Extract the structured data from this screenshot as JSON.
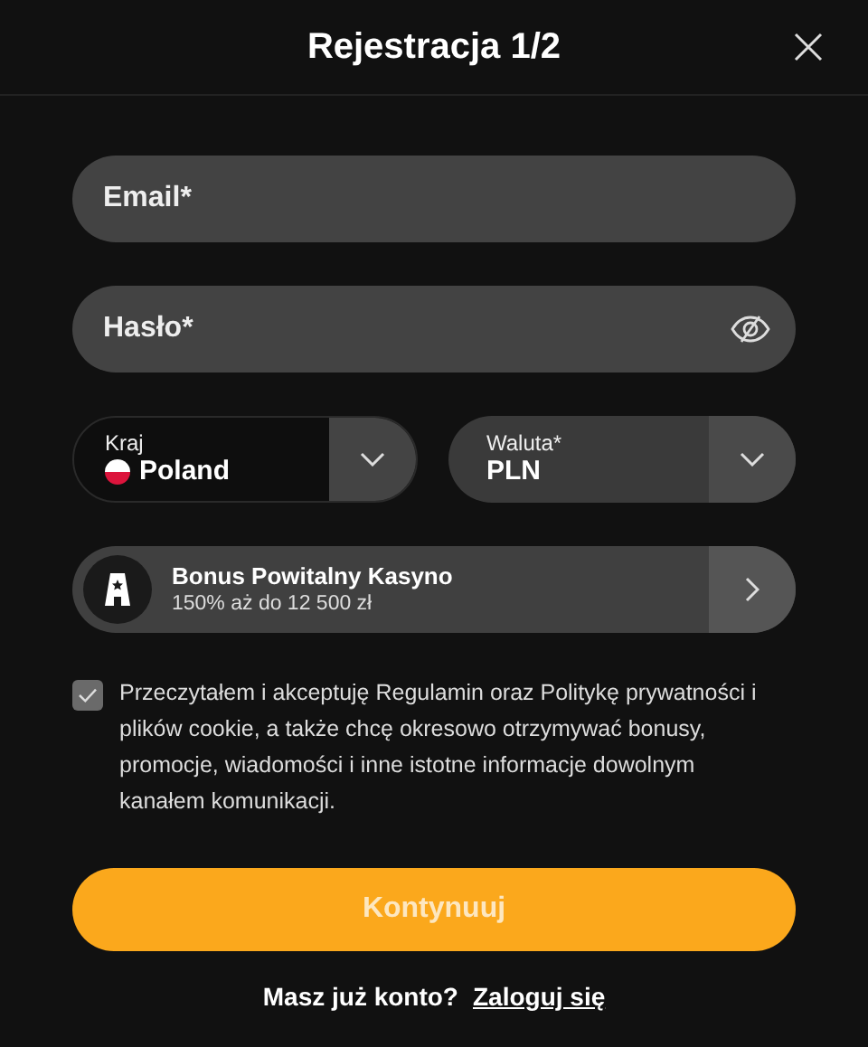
{
  "dialog": {
    "title": "Rejestracja 1/2"
  },
  "fields": [
    {
      "kind": "text",
      "placeholder": "Email*"
    },
    {
      "kind": "password",
      "placeholder": "Hasło*"
    }
  ],
  "selects": [
    {
      "kind": "country",
      "label": "Kraj",
      "value": "Poland"
    },
    {
      "kind": "currency",
      "label": "Waluta*",
      "value": "PLN"
    }
  ],
  "bonus": {
    "title": "Bonus Powitalny Kasyno",
    "subtitle": "150% aż do 12 500 zł"
  },
  "consent": {
    "checked": true,
    "text": "Przeczytałem i akceptuję Regulamin oraz Politykę prywatności i plików cookie, a także chcę okresowo otrzymywać bonusy, promocje, wiadomości i inne istotne informacje dowolnym kanałem komunikacji."
  },
  "submit": {
    "label": "Kontynuuj"
  },
  "login_prompt": {
    "text": "Masz już konto?",
    "link": "Zaloguj się"
  }
}
